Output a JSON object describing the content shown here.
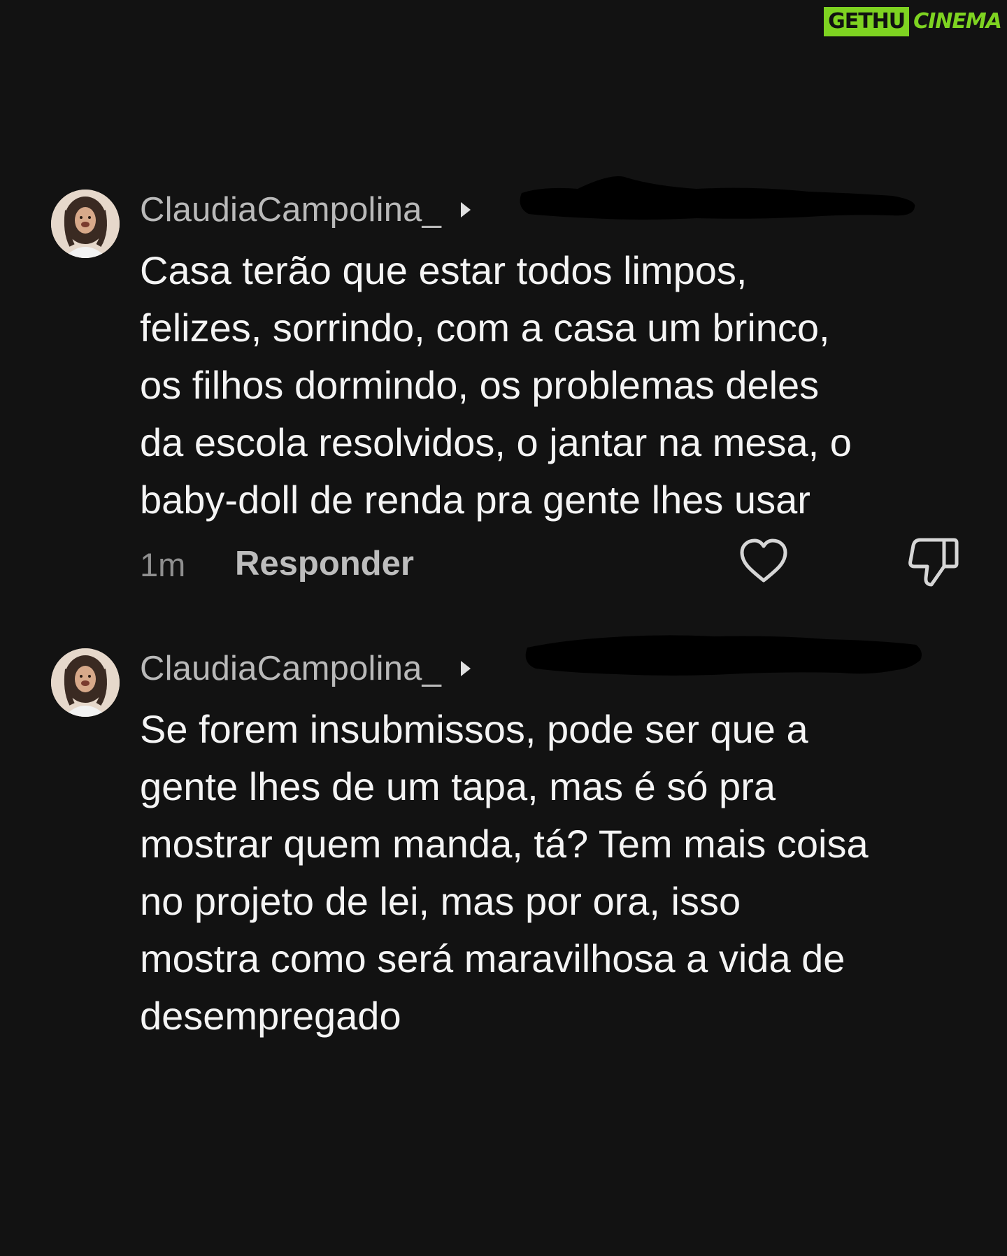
{
  "watermark": {
    "left": "GETHU",
    "right": "CINEMA",
    "brand_color": "#7ed321"
  },
  "comments": [
    {
      "username": "ClaudiaCampolina_",
      "reply_icon": "caret-right-icon",
      "text_lines": [
        "Casa terão que estar todos limpos,",
        "felizes, sorrindo, com a casa um brinco,",
        "os filhos dormindo, os problemas deles",
        "da escola resolvidos, o jantar na mesa, o",
        "baby-doll de renda pra gente lhes usar"
      ],
      "time": "1m",
      "reply_label": "Responder",
      "like_icon": "heart-icon",
      "dislike_icon": "thumbs-down-icon"
    },
    {
      "username": "ClaudiaCampolina_",
      "reply_icon": "caret-right-icon",
      "text_lines": [
        "Se forem insubmissos, pode ser que a",
        "gente lhes de um tapa, mas é só pra",
        "mostrar quem manda, tá? Tem mais coisa",
        "no projeto de lei, mas por ora, isso",
        "mostra como será maravilhosa a vida de",
        "desempregado"
      ]
    }
  ],
  "colors": {
    "background": "#121212",
    "text": "#f4f4f4",
    "muted": "#b9b9b9"
  }
}
